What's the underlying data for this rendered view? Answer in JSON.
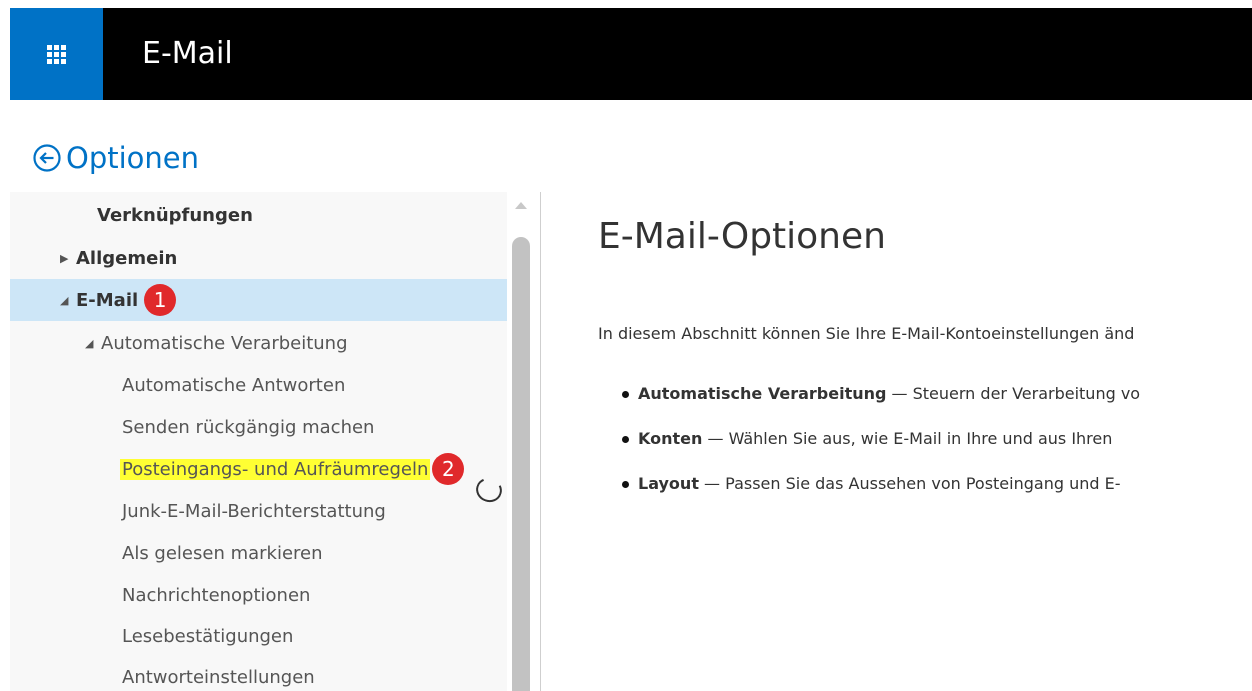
{
  "header": {
    "app_title": "E-Mail",
    "waffle_icon": "app-launcher-icon",
    "brand_color": "#0072c6"
  },
  "options": {
    "title": "Optionen",
    "back_icon": "back-arrow-circle-icon"
  },
  "nav": {
    "items": [
      {
        "label": "Verknüpfungen"
      },
      {
        "label": "Allgemein"
      },
      {
        "label": "E-Mail",
        "badge": "1"
      },
      {
        "label": "Automatische Verarbeitung"
      },
      {
        "label": "Automatische Antworten"
      },
      {
        "label": "Senden rückgängig machen"
      },
      {
        "label": "Posteingangs- und Aufräumregeln",
        "badge": "2"
      },
      {
        "label": "Junk-E-Mail-Berichterstattung"
      },
      {
        "label": "Als gelesen markieren"
      },
      {
        "label": "Nachrichtenoptionen"
      },
      {
        "label": "Lesebestätigungen"
      },
      {
        "label": "Antworteinstellungen"
      }
    ]
  },
  "content": {
    "title": "E-Mail-Optionen",
    "intro": "In diesem Abschnitt können Sie Ihre E-Mail-Kontoeinstellungen änd",
    "bullets": [
      {
        "term": "Automatische Verarbeitung",
        "text": " — Steuern der Verarbeitung vo"
      },
      {
        "term": "Konten",
        "text": " — Wählen Sie aus, wie E-Mail in Ihre und aus Ihren "
      },
      {
        "term": "Layout",
        "text": " — Passen Sie das Aussehen von Posteingang und E-"
      }
    ]
  },
  "colors": {
    "selected_bg": "#cde6f7",
    "highlight": "#ffff33",
    "badge": "#e0292b"
  }
}
